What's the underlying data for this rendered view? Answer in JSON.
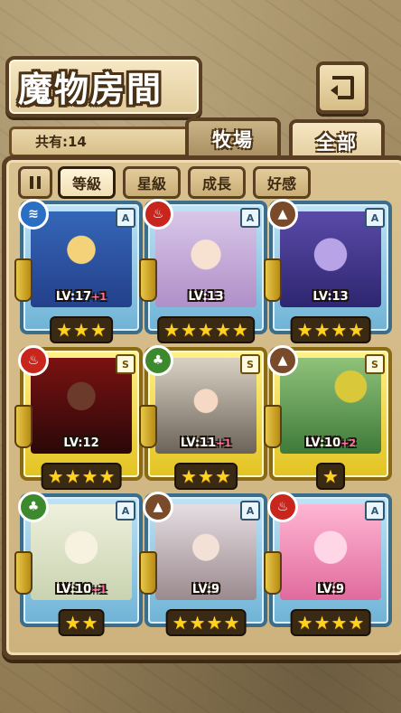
{
  "header": {
    "title": "魔物房間"
  },
  "count": {
    "label": "共有:14"
  },
  "tabs": [
    {
      "label": "牧場"
    },
    {
      "label": "全部"
    }
  ],
  "sort": {
    "buttons": [
      {
        "label": "等級"
      },
      {
        "label": "星級"
      },
      {
        "label": "成長"
      },
      {
        "label": "好感"
      }
    ]
  },
  "cards": [
    {
      "element": "water",
      "rank": "A",
      "level": "LV:17",
      "plus": "+1",
      "stars": 3
    },
    {
      "element": "fire",
      "rank": "A",
      "level": "LV:13",
      "plus": "",
      "stars": 5
    },
    {
      "element": "earth",
      "rank": "A",
      "level": "LV:13",
      "plus": "",
      "stars": 4
    },
    {
      "element": "fire",
      "rank": "S",
      "level": "LV:12",
      "plus": "",
      "stars": 4
    },
    {
      "element": "wood",
      "rank": "S",
      "level": "LV:11",
      "plus": "+1",
      "stars": 3
    },
    {
      "element": "earth",
      "rank": "S",
      "level": "LV:10",
      "plus": "+2",
      "stars": 1
    },
    {
      "element": "wood",
      "rank": "A",
      "level": "LV:10",
      "plus": "+1",
      "stars": 2
    },
    {
      "element": "earth",
      "rank": "A",
      "level": "LV:9",
      "plus": "",
      "stars": 4
    },
    {
      "element": "fire",
      "rank": "A",
      "level": "LV:9",
      "plus": "",
      "stars": 4
    }
  ]
}
